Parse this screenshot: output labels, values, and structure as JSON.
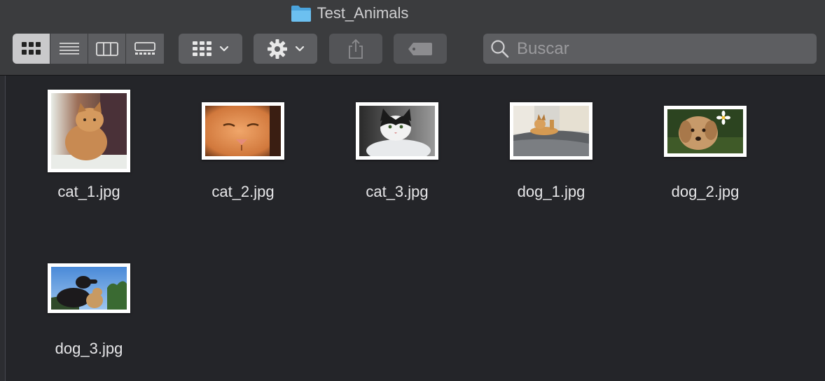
{
  "window": {
    "title": "Test_Animals"
  },
  "toolbar": {
    "view_buttons": [
      {
        "name": "icon-view",
        "active": true
      },
      {
        "name": "list-view",
        "active": false
      },
      {
        "name": "column-view",
        "active": false
      },
      {
        "name": "gallery-view",
        "active": false
      }
    ],
    "group_button_icon": "group-grid-icon",
    "action_button_icon": "gear-icon",
    "share_button_icon": "share-icon",
    "tag_button_icon": "tag-icon"
  },
  "search": {
    "placeholder": "Buscar",
    "value": ""
  },
  "files": [
    {
      "name": "cat_1.jpg"
    },
    {
      "name": "cat_2.jpg"
    },
    {
      "name": "cat_3.jpg"
    },
    {
      "name": "dog_1.jpg"
    },
    {
      "name": "dog_2.jpg"
    },
    {
      "name": "dog_3.jpg"
    }
  ],
  "colors": {
    "background": "#242529",
    "toolbar": "#3b3c3e",
    "folder_accent": "#5fb3e8"
  }
}
